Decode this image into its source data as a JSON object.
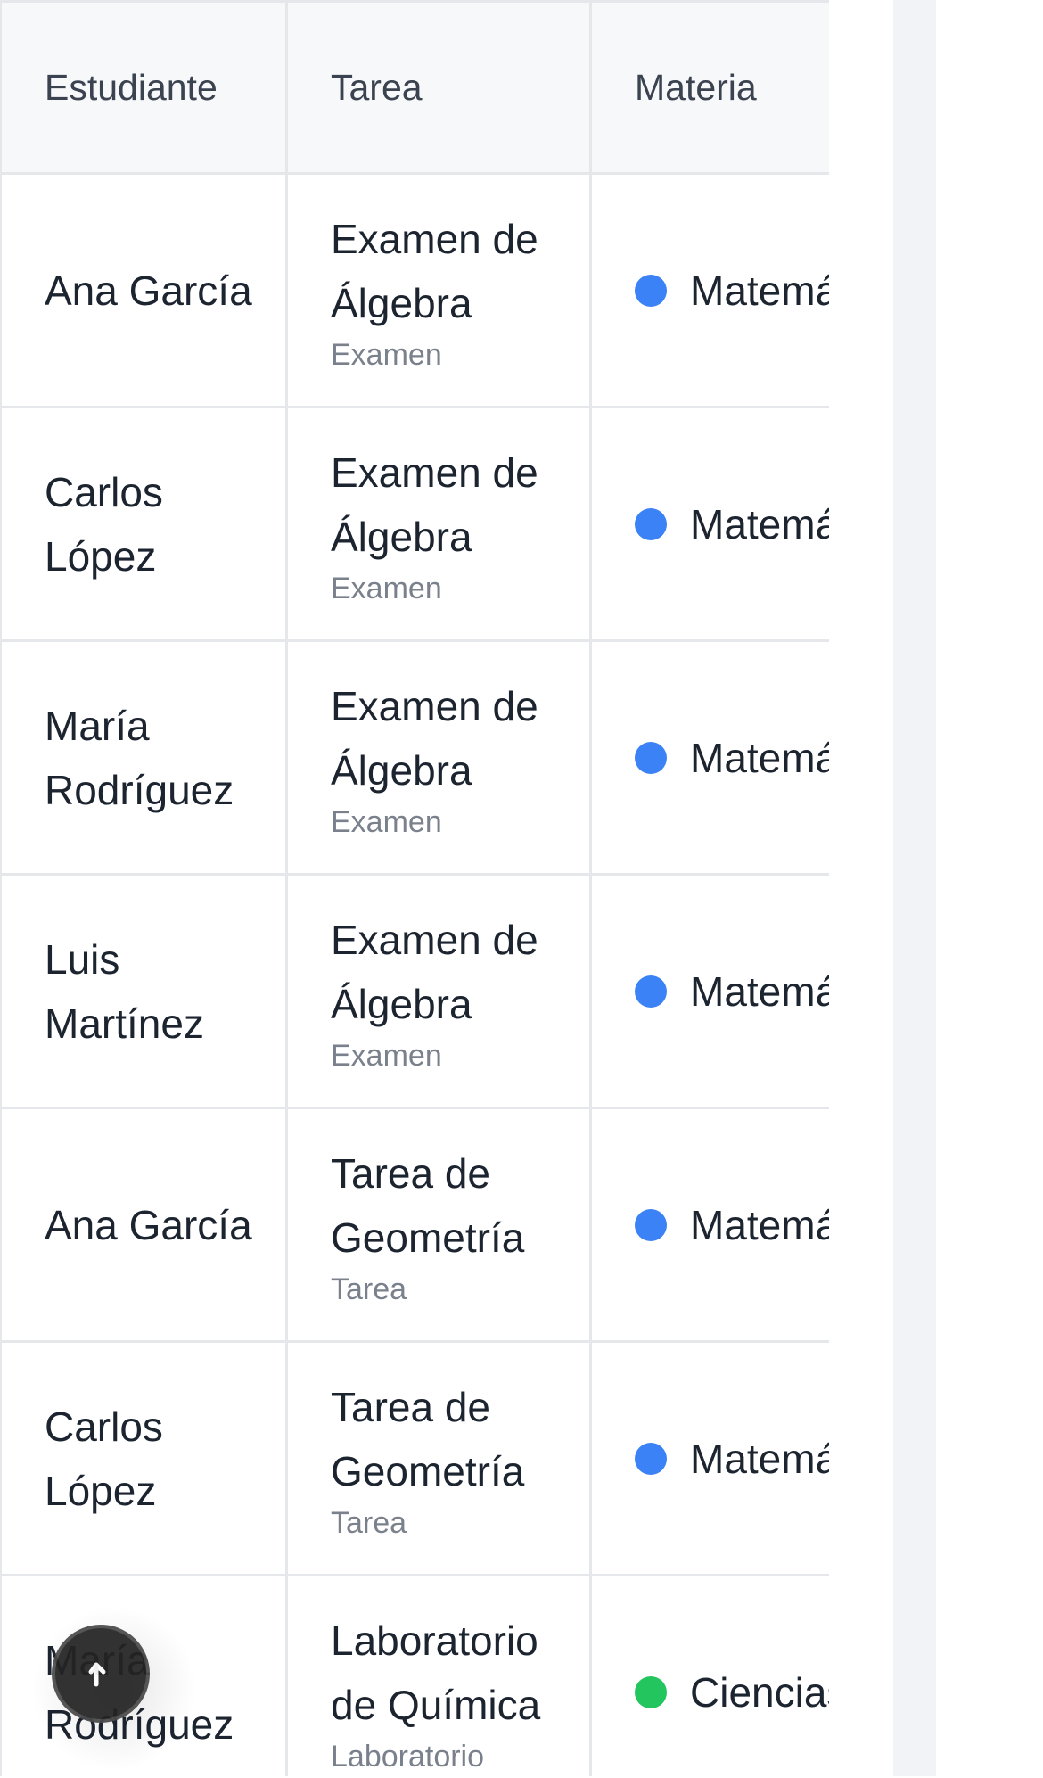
{
  "table": {
    "headers": {
      "student": "Estudiante",
      "task": "Tarea",
      "subject": "Materia"
    },
    "rows": [
      {
        "student": "Ana García",
        "task_title": "Examen de Álgebra",
        "task_type": "Examen",
        "subject": "Matemáticas",
        "subject_color": "#3b82f6"
      },
      {
        "student": "Carlos López",
        "task_title": "Examen de Álgebra",
        "task_type": "Examen",
        "subject": "Matemáticas",
        "subject_color": "#3b82f6"
      },
      {
        "student": "María Rodríguez",
        "task_title": "Examen de Álgebra",
        "task_type": "Examen",
        "subject": "Matemáticas",
        "subject_color": "#3b82f6"
      },
      {
        "student": "Luis Martínez",
        "task_title": "Examen de Álgebra",
        "task_type": "Examen",
        "subject": "Matemáticas",
        "subject_color": "#3b82f6"
      },
      {
        "student": "Ana García",
        "task_title": "Tarea de Geometría",
        "task_type": "Tarea",
        "subject": "Matemáticas",
        "subject_color": "#3b82f6"
      },
      {
        "student": "Carlos López",
        "task_title": "Tarea de Geometría",
        "task_type": "Tarea",
        "subject": "Matemáticas",
        "subject_color": "#3b82f6"
      },
      {
        "student": "María Rodríguez",
        "task_title": "Laboratorio de Química",
        "task_type": "Laboratorio",
        "subject": "Ciencias",
        "subject_color": "#22c55e"
      }
    ]
  },
  "fab": {
    "icon": "arrow-up-icon"
  }
}
